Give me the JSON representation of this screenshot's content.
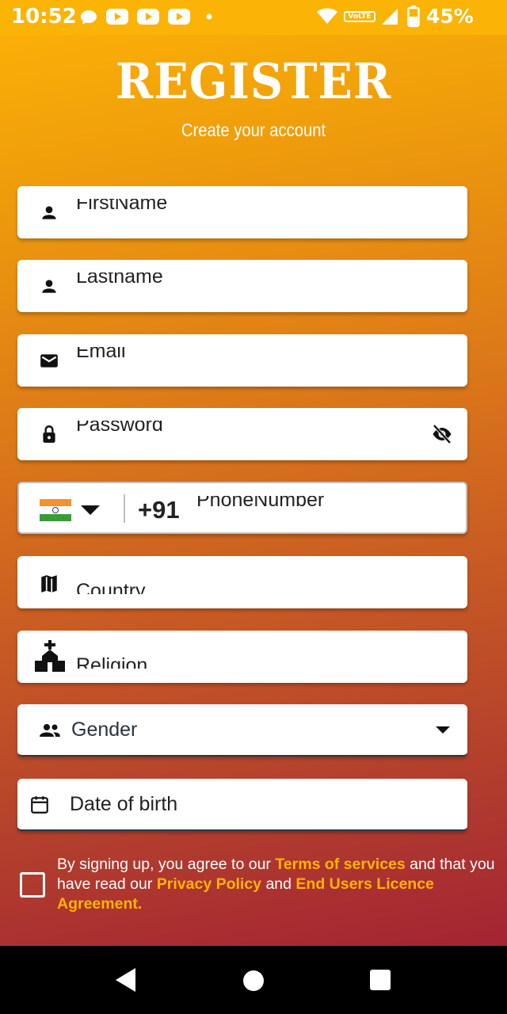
{
  "status_bar": {
    "time": "10:52",
    "network_badge": "VoLTE",
    "battery_percent": "45%",
    "notification_icons": [
      "chat-bubble-icon",
      "youtube-icon",
      "youtube-icon",
      "youtube-icon",
      "dot-icon"
    ]
  },
  "header": {
    "title": "REGISTER",
    "subtitle": "Create your account"
  },
  "form": {
    "first_name_placeholder": "FirstName",
    "last_name_placeholder": "Lastname",
    "email_placeholder": "Email",
    "password_placeholder": "Password",
    "phone": {
      "country_flag": "india-flag",
      "dial_code": "+91",
      "placeholder": "PhoneNumber"
    },
    "country_placeholder": "Country",
    "religion_placeholder": "Religion",
    "gender_label": "Gender",
    "dob_label": "Date of birth"
  },
  "agreement": {
    "text_1": "By signing up, you agree to our ",
    "terms_link": "Terms of services",
    "text_2": " and that you have read our ",
    "privacy_link": "Privacy Policy",
    "text_3": " and ",
    "eula_link": "End Users Licence Agreement.",
    "checked": false
  },
  "colors": {
    "gradient_top": "#fdb306",
    "gradient_bottom": "#a42433",
    "link": "#fdb406",
    "field_bg": "#ffffff"
  }
}
